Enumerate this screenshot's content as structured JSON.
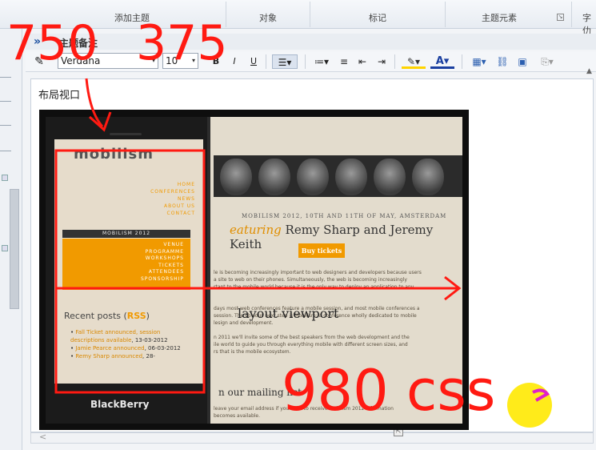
{
  "ribbon": {
    "groups": [
      "添加主题",
      "对象",
      "标记",
      "主题元素",
      "字仂"
    ],
    "launcher_glyph": "↘"
  },
  "panel": {
    "chevron": "»",
    "title": "主题备注"
  },
  "toolbar": {
    "font_name": "Verdana",
    "font_size": "10",
    "bold": "B",
    "italic": "I",
    "underline": "U",
    "dropdown_glyph": "▾"
  },
  "editor": {
    "heading": "布局视口",
    "scroll_arrow": "<"
  },
  "website": {
    "logo": "mobilism",
    "menu": [
      "HOME",
      "CONFERENCES",
      "NEWS",
      "ABOUT US",
      "CONTACT"
    ],
    "conf_bar": "MOBILISM 2012",
    "orange_menu": [
      "VENUE",
      "PROGRAMME",
      "WORKSHOPS",
      "TICKETS",
      "ATTENDEES",
      "SPONSORSHIP"
    ],
    "event_date": "MOBILISM 2012, 10TH AND 11TH OF MAY, AMSTERDAM",
    "event_title_prefix": "eaturing",
    "event_title_names": "Remy Sharp and Jeremy Keith",
    "buy_button": "Buy tickets",
    "content_lines": [
      "le is becoming increasingly important to web designers and developers because users",
      "a site to web on their phones. Simultaneously, the web is becoming increasingly",
      "rtant to the mobile world because it is the only way to deploy an application to any",
      "",
      "",
      "days most web conferences feature a mobile session, and most mobile conferences a",
      "session. The obvious next step is Mobilism: a conference wholly dedicated to mobile",
      "lesign and development.",
      "",
      "n 2011 we'll invite some of the best speakers from the web development and the",
      "ile world to guide you through everything mobile with different screen sizes, and",
      "rs that is the mobile ecosystem."
    ],
    "viewport_label": "layout viewport",
    "mailing": "n our mailing list",
    "mailing_text": [
      "leave your email address if you want to receive Mobilism 2012 information",
      "becomes available."
    ],
    "recent_label": "Recent posts (",
    "recent_rss": "RSS",
    "recent_close": ")",
    "posts": [
      {
        "link": "Fall Ticket announced, session descriptions available",
        "date": ", 13-03-2012"
      },
      {
        "link": "Jamie Pearce announced",
        "date": ", 06-03-2012"
      },
      {
        "link": "Remy Sharp announced",
        "date": ", 28-"
      }
    ],
    "phone_brand": "BlackBerry"
  },
  "annotations": {
    "width_750": "750",
    "width_375": "375",
    "css_980": "980 css"
  },
  "colors": {
    "accent_orange": "#f19a00",
    "annotation_red": "#ff1a12",
    "cursor_yellow": "#ffeb1a"
  }
}
